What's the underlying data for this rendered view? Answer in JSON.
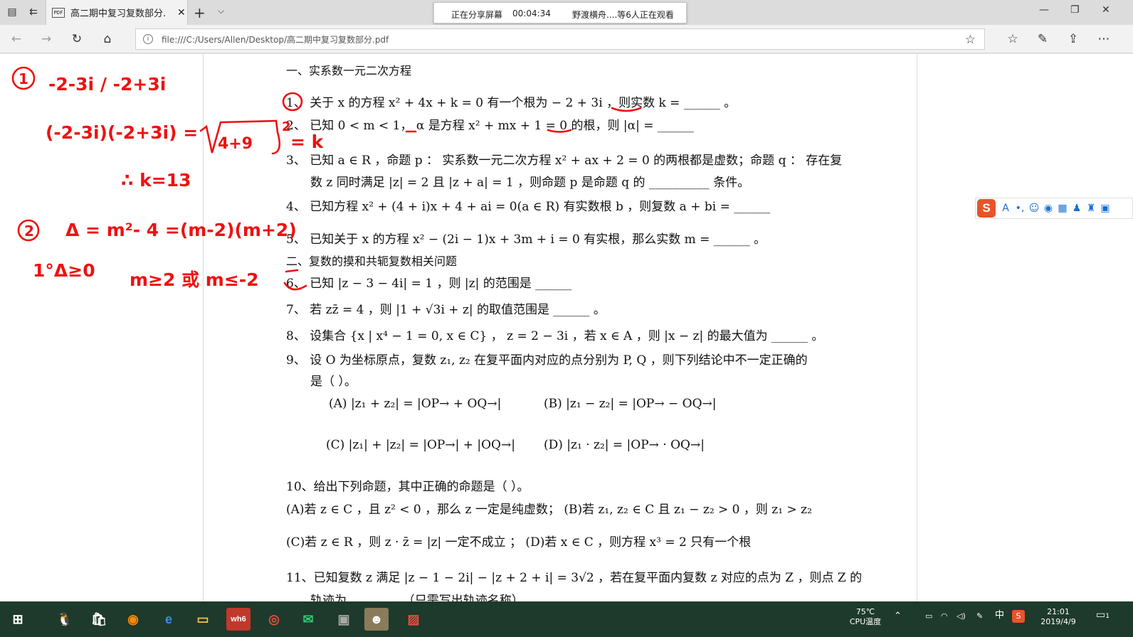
{
  "browser": {
    "tab_title": "高二期中复习复数部分.",
    "pdf_badge": "PDF",
    "url": "file:///C:/Users/Allen/Desktop/高二期中复习复数部分.pdf"
  },
  "share_bar": {
    "status": "正在分享屏幕",
    "time": "00:04:34",
    "viewers": "野渡横舟....等6人正在观看"
  },
  "document": {
    "section1": "一、实系数一元二次方程",
    "q1": "1、 关于 x 的方程 x² + 4x + k = 0 有一个根为 − 2 + 3i ，则实数 k = ______ 。",
    "q2": "2、 已知 0 < m < 1， α 是方程 x² + mx + 1 = 0 的根，则 |α| = ______",
    "q3a": "3、 已知 a ∈ R ，命题 p ： 实系数一元二次方程 x² + ax + 2 = 0 的两根都是虚数；命题 q ： 存在复",
    "q3b": "数 z 同时满足 |z| = 2 且 |z + a| = 1 ，则命题 p 是命题 q 的 __________ 条件。",
    "q4": "4、 已知方程 x² + (4 + i)x + 4 + ai = 0(a ∈ R) 有实数根 b ，则复数 a + bi = ______",
    "q5": "5、 已知关于 x 的方程 x² − (2i − 1)x + 3m + i = 0 有实根，那么实数 m = ______ 。",
    "section2": "二、复数的摸和共轭复数相关问题",
    "q6": "6、 已知 |z − 3 − 4i| = 1 ，则 |z| 的范围是 ______",
    "q7": "7、 若 zz̄ = 4 ，则 |1 + √3i + z| 的取值范围是 ______ 。",
    "q8": "8、 设集合 {x | x⁴ − 1 = 0, x ∈ C} ， z = 2 − 3i ，若 x ∈ A ，则 |x − z| 的最大值为 ______ 。",
    "q9a": "9、 设 O 为坐标原点，复数 z₁, z₂ 在复平面内对应的点分别为 P, Q ，则下列结论中不一定正确的",
    "q9b": "是（ ）。",
    "q9A": "(A) |z₁ + z₂| = |OP→ + OQ→|",
    "q9B": "(B) |z₁ − z₂| = |OP→ − OQ→|",
    "q9C": "(C) |z₁| + |z₂| = |OP→| + |OQ→|",
    "q9D": "(D) |z₁ · z₂| = |OP→ · OQ→|",
    "q10": "10、给出下列命题，其中正确的命题是（ ）。",
    "q10AB": "(A)若 z ∈ C ，且 z² < 0 ，那么 z 一定是纯虚数； (B)若 z₁, z₂ ∈ C 且 z₁ − z₂ > 0 ，则 z₁ > z₂",
    "q10CD": "(C)若 z ∈ R ，则 z · z̄ = |z| 一定不成立        ；  (D)若 x ∈ C ，则方程 x³ = 2 只有一个根",
    "q11a": "11、已知复数 z 满足 |z − 1 − 2i| − |z + 2 + i| = 3√2 ，若在复平面内复数 z 对应的点为 Z ，则点 Z 的",
    "q11b": "轨迹为 ________ （只需写出轨迹名称）"
  },
  "annotations": {
    "a1": "① -2-3i / -2+3i",
    "a2": "(-2-3i)(-2+3i) = (√4+9)² = k",
    "a3": "∴ k=13",
    "a4": "② Δ = m²-4 = (m-2)(m+2)",
    "a5": "1° Δ≥0   m≥2 或 m≤-2"
  },
  "ime": {
    "logo": "S",
    "mode": "A"
  },
  "taskbar": {
    "wh_label": "wh6",
    "temp": "75℃",
    "temp_label": "CPU温度",
    "lang": "中",
    "time": "21:01",
    "date": "2019/4/9",
    "notif_count": "1"
  }
}
